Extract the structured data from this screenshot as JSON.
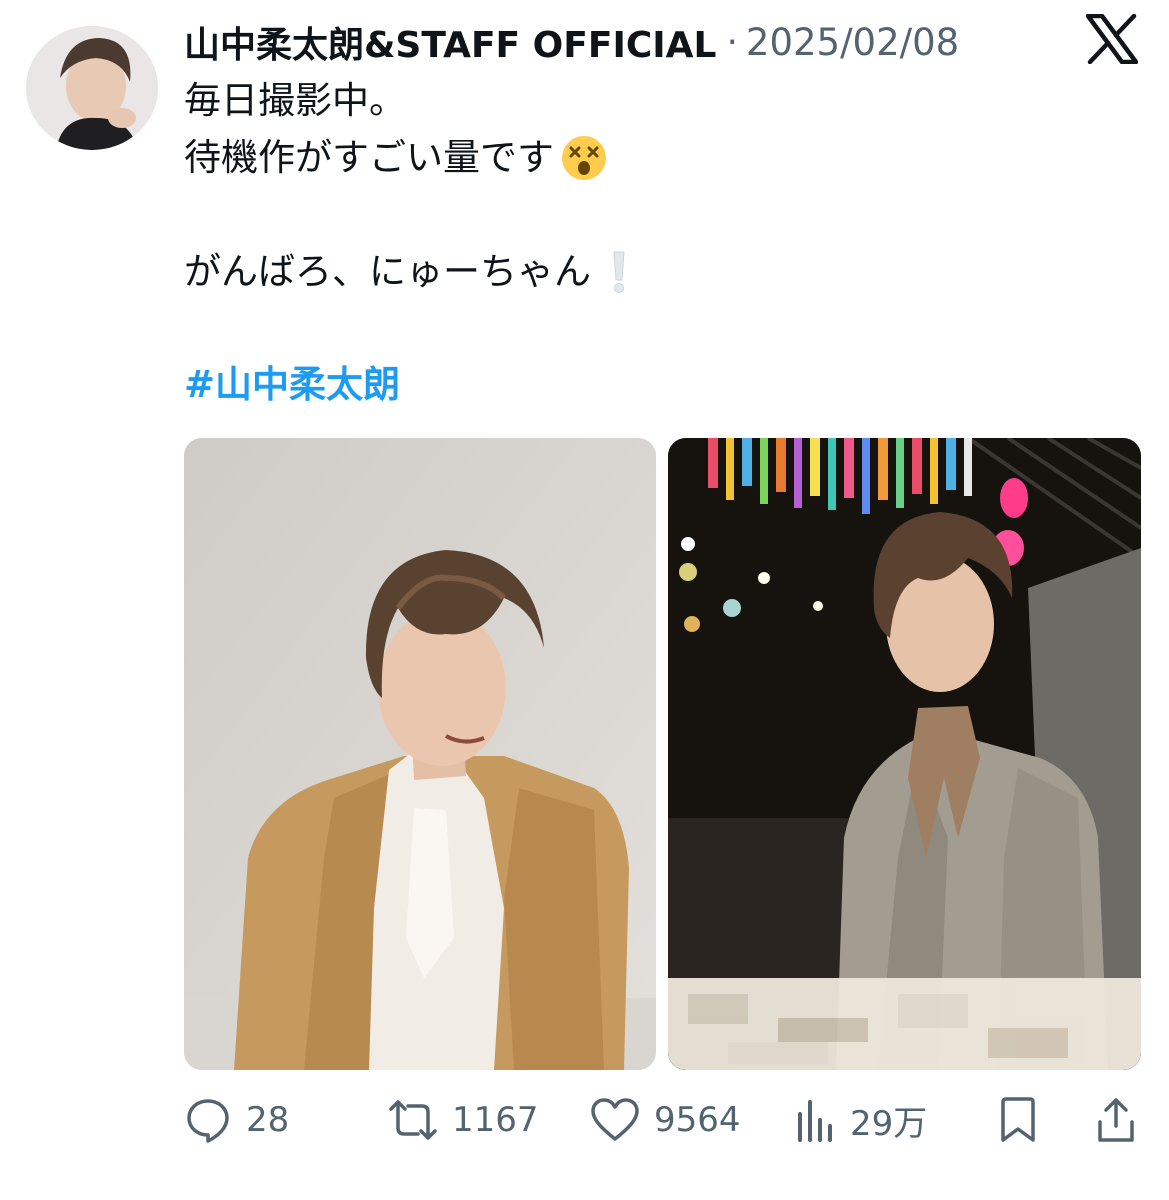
{
  "post": {
    "author": {
      "display_name": "山中柔太朗&STAFF OFFICIAL"
    },
    "separator": "·",
    "date": "2025/02/08",
    "lines": [
      "毎日撮影中。",
      "待機作がすごい量です",
      "",
      "がんばろ、にゅーちゃん",
      ""
    ],
    "hashtag": "#山中柔太朗",
    "emoji": {
      "dizzy_face": "dizzy-face-emoji",
      "exclamation": "white-exclamation-mark"
    }
  },
  "actions": {
    "reply": {
      "icon": "reply-icon",
      "count": "28"
    },
    "repost": {
      "icon": "repost-icon",
      "count": "1167"
    },
    "like": {
      "icon": "heart-icon",
      "count": "9564"
    },
    "views": {
      "icon": "views-icon",
      "count": "29万"
    },
    "bookmark": {
      "icon": "bookmark-icon"
    },
    "share": {
      "icon": "share-icon"
    }
  },
  "colors": {
    "text": "#0f1419",
    "muted": "#536471",
    "link": "#1d9bf0",
    "background": "#ffffff"
  }
}
